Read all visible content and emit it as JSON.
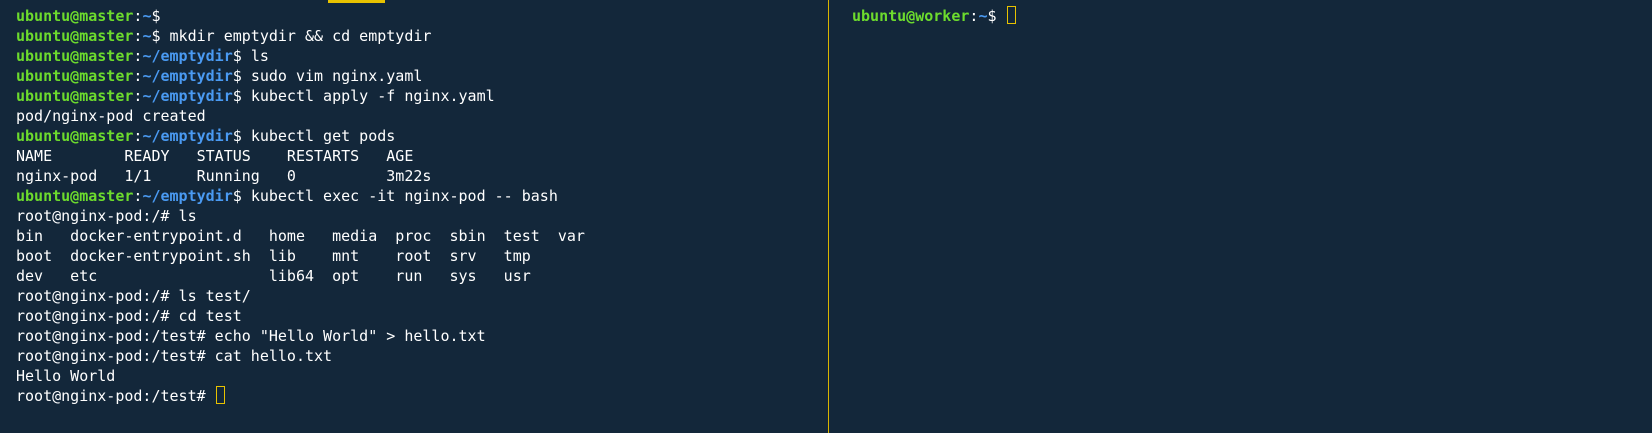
{
  "left_pane": {
    "lines": [
      {
        "type": "prompt",
        "user": "ubuntu@master",
        "colon": ":",
        "path": "~",
        "end": "$ ",
        "cmd": ""
      },
      {
        "type": "prompt",
        "user": "ubuntu@master",
        "colon": ":",
        "path": "~",
        "end": "$ ",
        "cmd": "mkdir emptydir && cd emptydir"
      },
      {
        "type": "prompt",
        "user": "ubuntu@master",
        "colon": ":",
        "path": "~/emptydir",
        "end": "$ ",
        "cmd": "ls"
      },
      {
        "type": "prompt",
        "user": "ubuntu@master",
        "colon": ":",
        "path": "~/emptydir",
        "end": "$ ",
        "cmd": "sudo vim nginx.yaml"
      },
      {
        "type": "prompt",
        "user": "ubuntu@master",
        "colon": ":",
        "path": "~/emptydir",
        "end": "$ ",
        "cmd": "kubectl apply -f nginx.yaml"
      },
      {
        "type": "output",
        "text": "pod/nginx-pod created"
      },
      {
        "type": "prompt",
        "user": "ubuntu@master",
        "colon": ":",
        "path": "~/emptydir",
        "end": "$ ",
        "cmd": "kubectl get pods"
      },
      {
        "type": "output",
        "text": "NAME        READY   STATUS    RESTARTS   AGE"
      },
      {
        "type": "output",
        "text": "nginx-pod   1/1     Running   0          3m22s"
      },
      {
        "type": "prompt",
        "user": "ubuntu@master",
        "colon": ":",
        "path": "~/emptydir",
        "end": "$ ",
        "cmd": "kubectl exec -it nginx-pod -- bash"
      },
      {
        "type": "output",
        "text": "root@nginx-pod:/# ls"
      },
      {
        "type": "output",
        "text": "bin   docker-entrypoint.d   home   media  proc  sbin  test  var"
      },
      {
        "type": "output",
        "text": "boot  docker-entrypoint.sh  lib    mnt    root  srv   tmp"
      },
      {
        "type": "output",
        "text": "dev   etc                   lib64  opt    run   sys   usr"
      },
      {
        "type": "output",
        "text": "root@nginx-pod:/# ls test/"
      },
      {
        "type": "output",
        "text": "root@nginx-pod:/# cd test"
      },
      {
        "type": "output",
        "text": "root@nginx-pod:/test# echo \"Hello World\" > hello.txt"
      },
      {
        "type": "output",
        "text": "root@nginx-pod:/test# cat hello.txt"
      },
      {
        "type": "output",
        "text": "Hello World"
      },
      {
        "type": "output",
        "text": "root@nginx-pod:/test# ",
        "cursor": true
      }
    ]
  },
  "right_pane": {
    "lines": [
      {
        "type": "prompt",
        "user": "ubuntu@worker",
        "colon": ":",
        "path": "~",
        "end": "$ ",
        "cmd": "",
        "cursor": true
      }
    ]
  },
  "colors": {
    "background": "#13273a",
    "user": "#6ddc2d",
    "path": "#4a9af2",
    "text": "#ffffff",
    "accent": "#e8c200"
  }
}
